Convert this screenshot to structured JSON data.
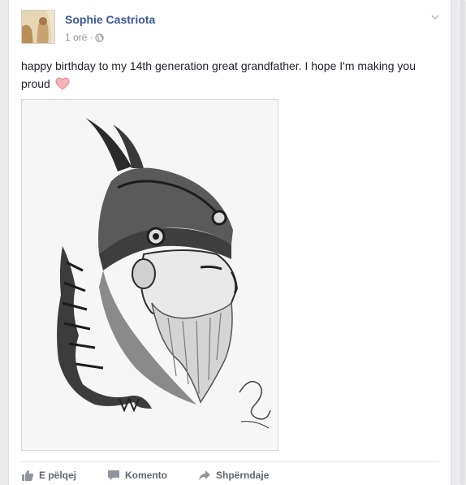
{
  "post": {
    "author": "Sophie Castriota",
    "timestamp": "1 orë",
    "separator": "·",
    "privacy_icon": "globe-icon",
    "text": "happy birthday to my 14th generation great grandfather. I hope I'm making you proud",
    "emoji": "heart-icon",
    "options_icon": "chevron-down-icon"
  },
  "actions": {
    "like_label": "E pëlqej",
    "comment_label": "Komento",
    "share_label": "Shpërndaje"
  },
  "colors": {
    "author_link": "#365899",
    "meta_text": "#90949c",
    "body_text": "#1d2129",
    "action_text": "#606770",
    "heart": "#f7a3a7"
  }
}
